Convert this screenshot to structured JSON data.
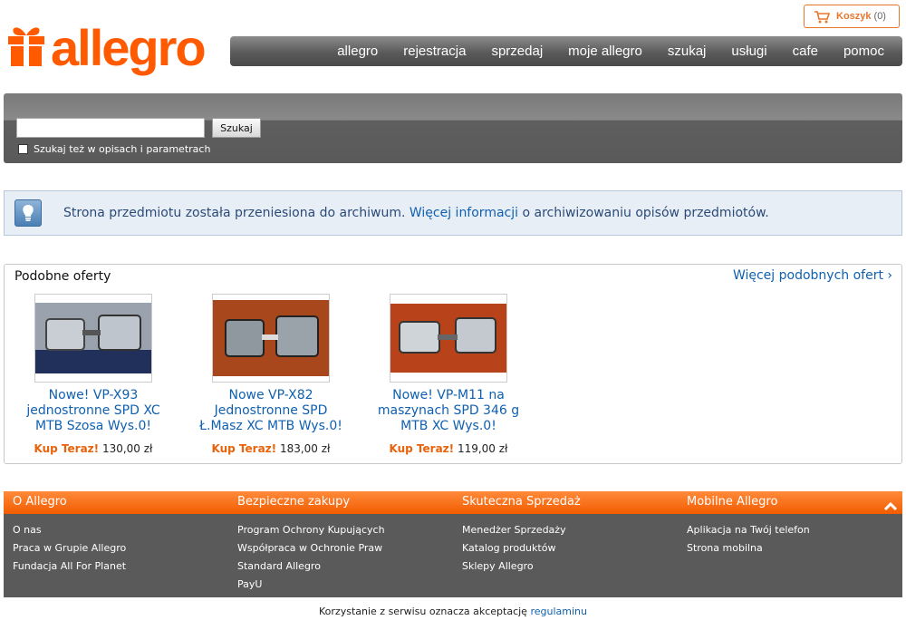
{
  "cart": {
    "label": "Koszyk",
    "count": "(0)"
  },
  "logo": {
    "text": "allegro"
  },
  "nav": [
    "allegro",
    "rejestracja",
    "sprzedaj",
    "moje allegro",
    "szukaj",
    "usługi",
    "cafe",
    "pomoc"
  ],
  "search": {
    "button": "Szukaj",
    "checkbox_label": "Szukaj też w opisach i parametrach",
    "value": ""
  },
  "info": {
    "text_before": "Strona przedmiotu została przeniesiona do archiwum.",
    "link": "Więcej informacji",
    "text_after": "o archiwizowaniu opisów przedmiotów."
  },
  "similar": {
    "title": "Podobne oferty",
    "more_link": "Więcej podobnych ofert ›",
    "buy_label": "Kup Teraz!",
    "items": [
      {
        "title": "Nowe! VP-X93 jednostronne SPD XC MTB Szosa Wys.0!",
        "price": "130,00 zł"
      },
      {
        "title": "Nowe VP-X82 Jednostronne SPD Ł.Masz XC MTB Wys.0!",
        "price": "183,00 zł"
      },
      {
        "title": "Nowe! VP-M11 na maszynach SPD 346 g MTB XC Wys.0!",
        "price": "119,00 zł"
      }
    ]
  },
  "footer": {
    "columns": [
      {
        "title": "O Allegro",
        "links": [
          "O nas",
          "Praca w Grupie Allegro",
          "Fundacja All For Planet"
        ]
      },
      {
        "title": "Bezpieczne zakupy",
        "links": [
          "Program Ochrony Kupujących",
          "Współpraca w Ochronie Praw",
          "Standard Allegro",
          "PayU"
        ]
      },
      {
        "title": "Skuteczna Sprzedaż",
        "links": [
          "Menedżer Sprzedaży",
          "Katalog produktów",
          "Sklepy Allegro"
        ]
      },
      {
        "title": "Mobilne Allegro",
        "links": [
          "Aplikacja na Twój telefon",
          "Strona mobilna"
        ]
      }
    ]
  },
  "bottom": {
    "text": "Korzystanie z serwisu oznacza akceptację",
    "link": "regulaminu"
  },
  "colors": {
    "brand": "#ff5a00",
    "link": "#1060b0"
  }
}
